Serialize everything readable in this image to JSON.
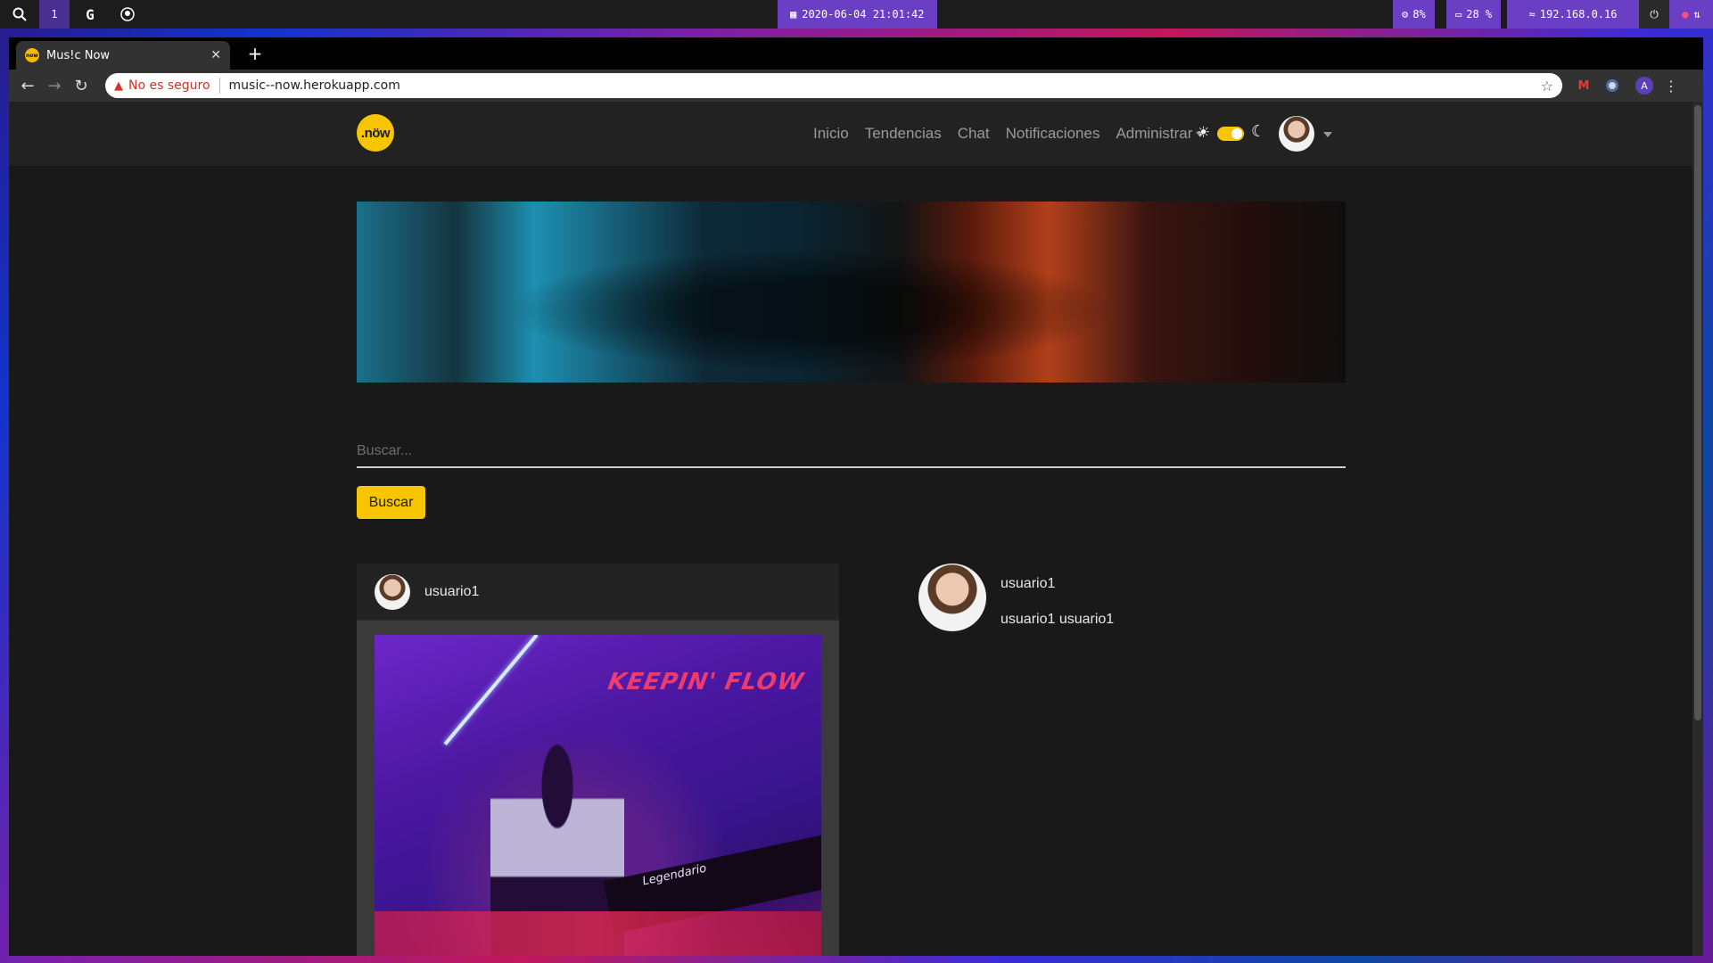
{
  "system_bar": {
    "workspace": "1",
    "clock": "2020-06-04 21:01:42",
    "cpu": "8%",
    "disk": "28 %",
    "ip": "192.168.0.16"
  },
  "browser": {
    "tab_title": "Mus!c Now",
    "security_label": "No es seguro",
    "url": "music--now.herokuapp.com",
    "profile_initial": "A"
  },
  "site": {
    "logo_text": ".nöw",
    "nav": [
      "Inicio",
      "Tendencias",
      "Chat",
      "Notificaciones",
      "Administrar"
    ],
    "accent": "#f7c600",
    "search_placeholder": "Buscar...",
    "search_button": "Buscar"
  },
  "post": {
    "username": "usuario1",
    "image_title": "KEEPIN' FLOW",
    "image_label": "Legendario"
  },
  "profile": {
    "username": "usuario1",
    "full_name": "usuario1 usuario1"
  }
}
